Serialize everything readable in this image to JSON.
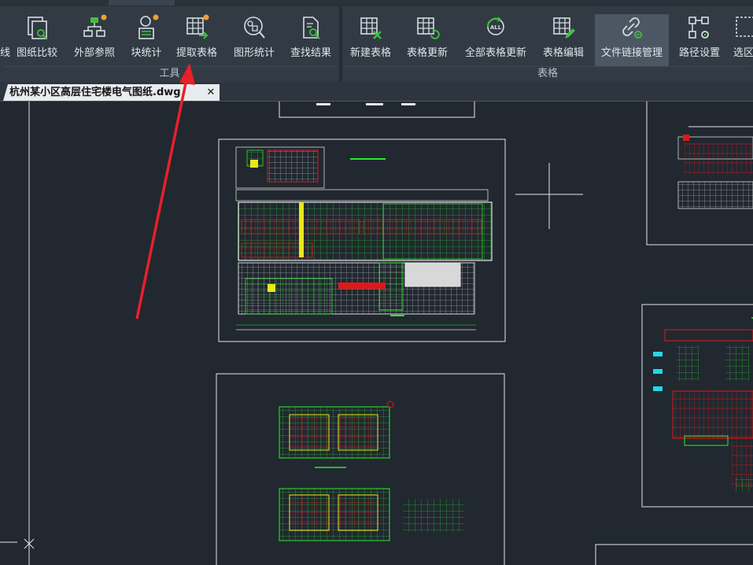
{
  "ribbon": {
    "tools_group_label": "工具",
    "table_group_label": "表格",
    "buttons": [
      {
        "label": "线",
        "icon": "partial-icon"
      },
      {
        "label": "图纸比较",
        "icon": "drawing-compare-icon"
      },
      {
        "label": "外部参照",
        "icon": "external-reference-icon"
      },
      {
        "label": "块统计",
        "icon": "block-statistics-icon"
      },
      {
        "label": "提取表格",
        "icon": "extract-table-icon"
      },
      {
        "label": "图形统计",
        "icon": "shape-statistics-icon"
      },
      {
        "label": "查找结果",
        "icon": "find-results-icon"
      },
      {
        "label": "新建表格",
        "icon": "new-table-icon"
      },
      {
        "label": "表格更新",
        "icon": "table-update-icon"
      },
      {
        "label": "全部表格更新",
        "icon": "update-all-tables-icon"
      },
      {
        "label": "表格编辑",
        "icon": "table-edit-icon"
      },
      {
        "label": "文件链接管理",
        "icon": "file-link-icon"
      },
      {
        "label": "路径设置",
        "icon": "path-settings-icon"
      },
      {
        "label": "选区",
        "icon": "selection-icon"
      }
    ]
  },
  "document": {
    "tab_title": "杭州某小区高层住宅楼电气图纸.dwg",
    "close_glyph": "✕"
  },
  "annotation": {
    "color": "#e8202a"
  },
  "colors": {
    "canvas_bg": "#212830",
    "ribbon_bg": "#323a44",
    "cad_green": "#2ee82e",
    "cad_red": "#e01818",
    "cad_yellow": "#e8e81c",
    "cad_cyan": "#20d8e8"
  }
}
